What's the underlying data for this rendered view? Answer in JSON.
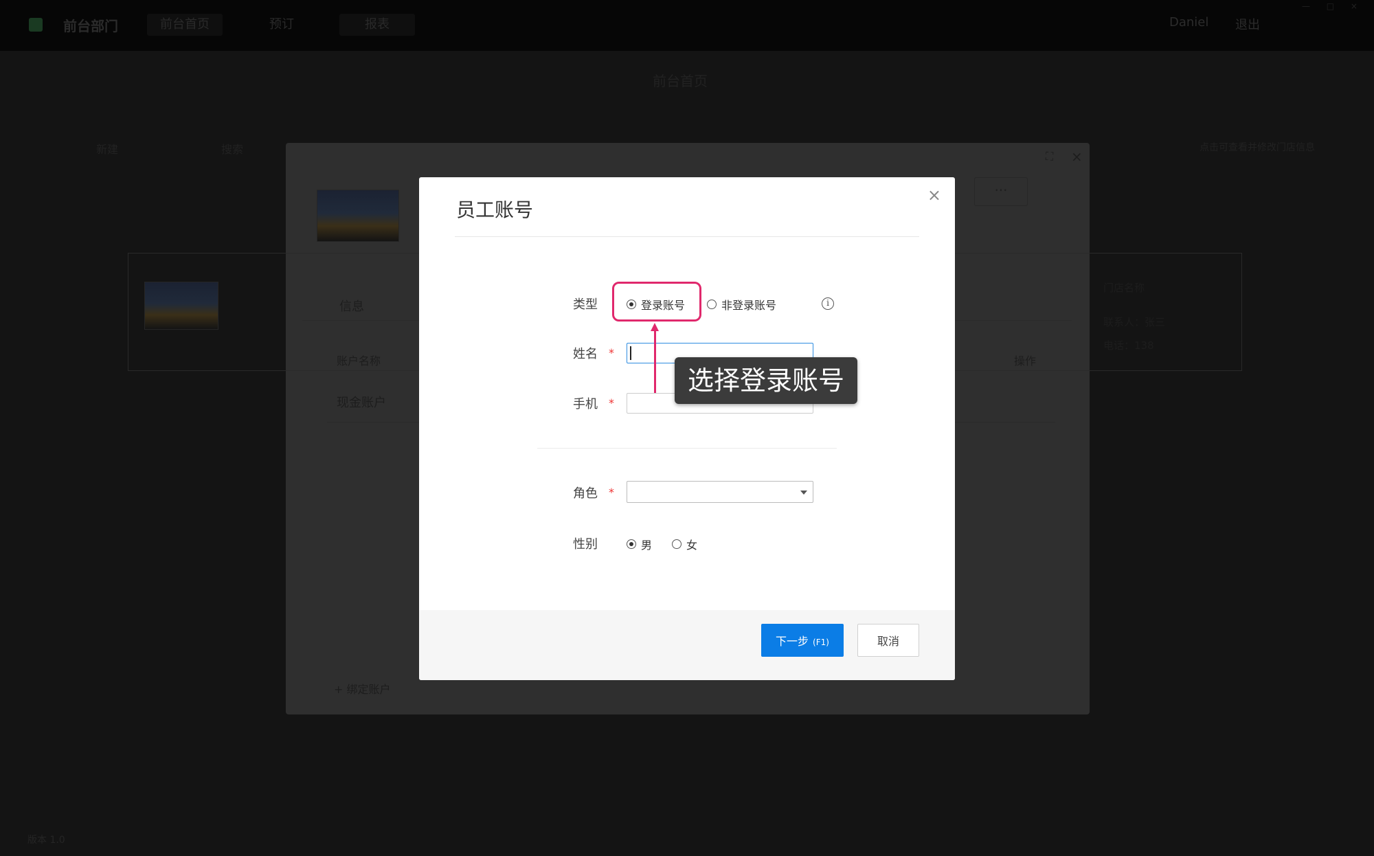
{
  "topbar": {
    "brand": "前台部门",
    "nav": [
      "前台首页",
      "预订",
      "报表"
    ],
    "right_items": [
      "Daniel",
      "退出"
    ],
    "window_controls": "— □ ×"
  },
  "background": {
    "heading": "前台首页",
    "crumbs": [
      "新建",
      "搜索"
    ],
    "tab_label": "信息",
    "col_account_name": "账户名称",
    "col_actions": "操作",
    "row_cash_account": "现金账户",
    "bind_account": "绑定账户",
    "right_hint": "点击可查看并修改门店信息",
    "card_lines": [
      "门店名称",
      "联系人：张三",
      "电话：138"
    ],
    "more_label": "···",
    "footer_text": "版本 1.0"
  },
  "dialog": {
    "title": "员工账号",
    "close": "×",
    "type_label": "类型",
    "type_options": [
      {
        "label": "登录账号",
        "selected": true
      },
      {
        "label": "非登录账号",
        "selected": false
      }
    ],
    "info_icon": "i",
    "name_label": "姓名",
    "name_value": "",
    "phone_label": "手机",
    "phone_value": "",
    "required_mark": "*",
    "role_label": "角色",
    "role_value": "",
    "gender_label": "性别",
    "gender_options": [
      {
        "label": "男",
        "selected": true
      },
      {
        "label": "女",
        "selected": false
      }
    ],
    "next_button": "下一步",
    "next_shortcut": "(F1)",
    "cancel_button": "取消"
  },
  "annotation": {
    "tooltip": "选择登录账号",
    "highlight_color": "#e0286c"
  },
  "colors": {
    "primary": "#0b7de6",
    "required": "#ee3333",
    "focus_border": "#2d8ce0"
  }
}
